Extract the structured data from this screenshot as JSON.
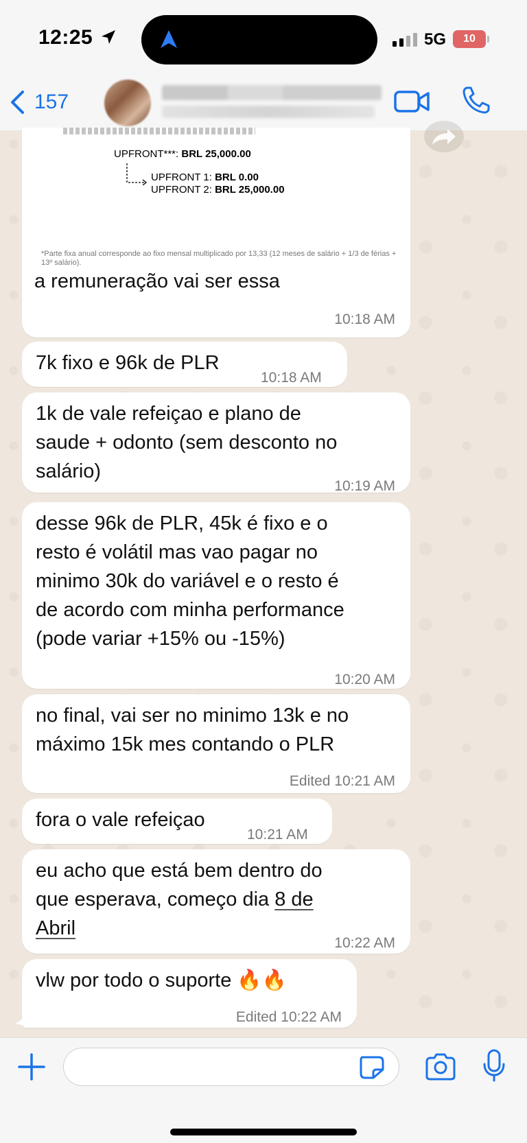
{
  "status_bar": {
    "time": "12:25",
    "network": "5G",
    "battery": "10"
  },
  "nav": {
    "back_count": "157"
  },
  "image_message": {
    "upfront_label": "UPFRONT***:",
    "upfront_value": "BRL 25,000.00",
    "upfront1_label": "UPFRONT 1:",
    "upfront1_value": "BRL 0.00",
    "upfront2_label": "UPFRONT 2:",
    "upfront2_value": "BRL 25,000.00",
    "footnote": "*Parte fixa anual corresponde ao fixo mensal multiplicado por 13,33 (12 meses de salário + 1/3 de férias + 13º salário).",
    "caption": "a remuneração vai ser essa",
    "time": "10:18 AM"
  },
  "messages": [
    {
      "lines": [
        "7k fixo e 96k de PLR"
      ],
      "time": "10:18 AM"
    },
    {
      "lines": [
        "1k de vale refeiçao e plano de",
        "saude + odonto (sem desconto no",
        "salário)"
      ],
      "time": "10:19 AM"
    },
    {
      "lines": [
        "desse 96k de PLR, 45k é fixo e o",
        "resto é volátil mas vao pagar no",
        "minimo 30k do variável e o resto é",
        "de acordo com minha performance",
        "(pode variar +15% ou -15%)"
      ],
      "time": "10:20 AM"
    },
    {
      "lines": [
        "no final, vai ser no minimo 13k e no",
        "máximo 15k mes contando o PLR"
      ],
      "time": "Edited  10:21 AM"
    },
    {
      "lines": [
        "fora o vale refeiçao"
      ],
      "time": "10:21 AM"
    },
    {
      "lines": [
        "eu acho que está bem dentro do",
        "que esperava, começo dia "
      ],
      "link_a": "8 de",
      "link_b": "Abril",
      "time": "10:22 AM"
    },
    {
      "lines": [
        "vlw por todo o suporte 🔥🔥"
      ],
      "time": "Edited  10:22 AM"
    }
  ],
  "composer": {
    "placeholder": ""
  },
  "colors": {
    "accent": "#1a73e8",
    "chat_bg": "#efe7dd",
    "bubble": "#ffffff"
  },
  "icons": [
    "location-arrow-icon",
    "maps-a-icon",
    "signal-icon",
    "chevron-left-icon",
    "video-camera-icon",
    "phone-icon",
    "forward-icon",
    "plus-icon",
    "sticker-icon",
    "camera-icon",
    "microphone-icon"
  ]
}
